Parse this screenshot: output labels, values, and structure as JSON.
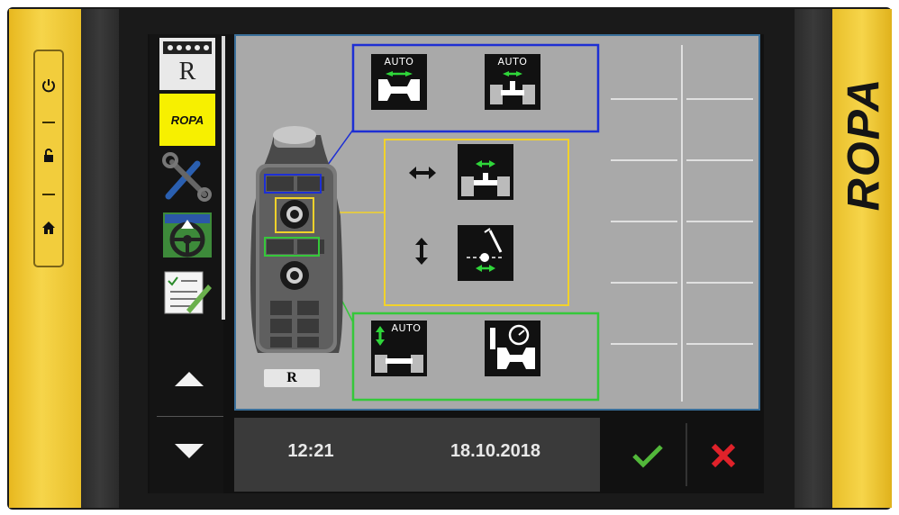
{
  "brand": {
    "logo_text": "ROPA"
  },
  "sidebar": {
    "items": [
      {
        "name": "machine-r-icon",
        "label": "R"
      },
      {
        "name": "ropa-logo-icon",
        "label": "ROPA"
      },
      {
        "name": "tools-icon"
      },
      {
        "name": "steering-wheel-icon"
      },
      {
        "name": "checklist-icon"
      }
    ],
    "up_arrow": "scroll-up-icon",
    "down_arrow": "scroll-down-icon"
  },
  "joystick": {
    "label": "R"
  },
  "functions": {
    "auto_label": "AUTO",
    "blue_group": [
      "auto-width-icon",
      "auto-depth-icon"
    ],
    "yellow_group": [
      "horizontal-move-icon",
      "vertical-move-icon"
    ],
    "green_group": [
      "auto-height-icon",
      "pressure-gauge-icon"
    ]
  },
  "status": {
    "time": "12:21",
    "date": "18.10.2018"
  },
  "colors": {
    "blue": "#1d2fd4",
    "yellow": "#f2d22a",
    "green": "#35c83a",
    "screen_gray": "#a9a9a9",
    "confirm": "#52b83a",
    "cancel": "#e0222a"
  }
}
